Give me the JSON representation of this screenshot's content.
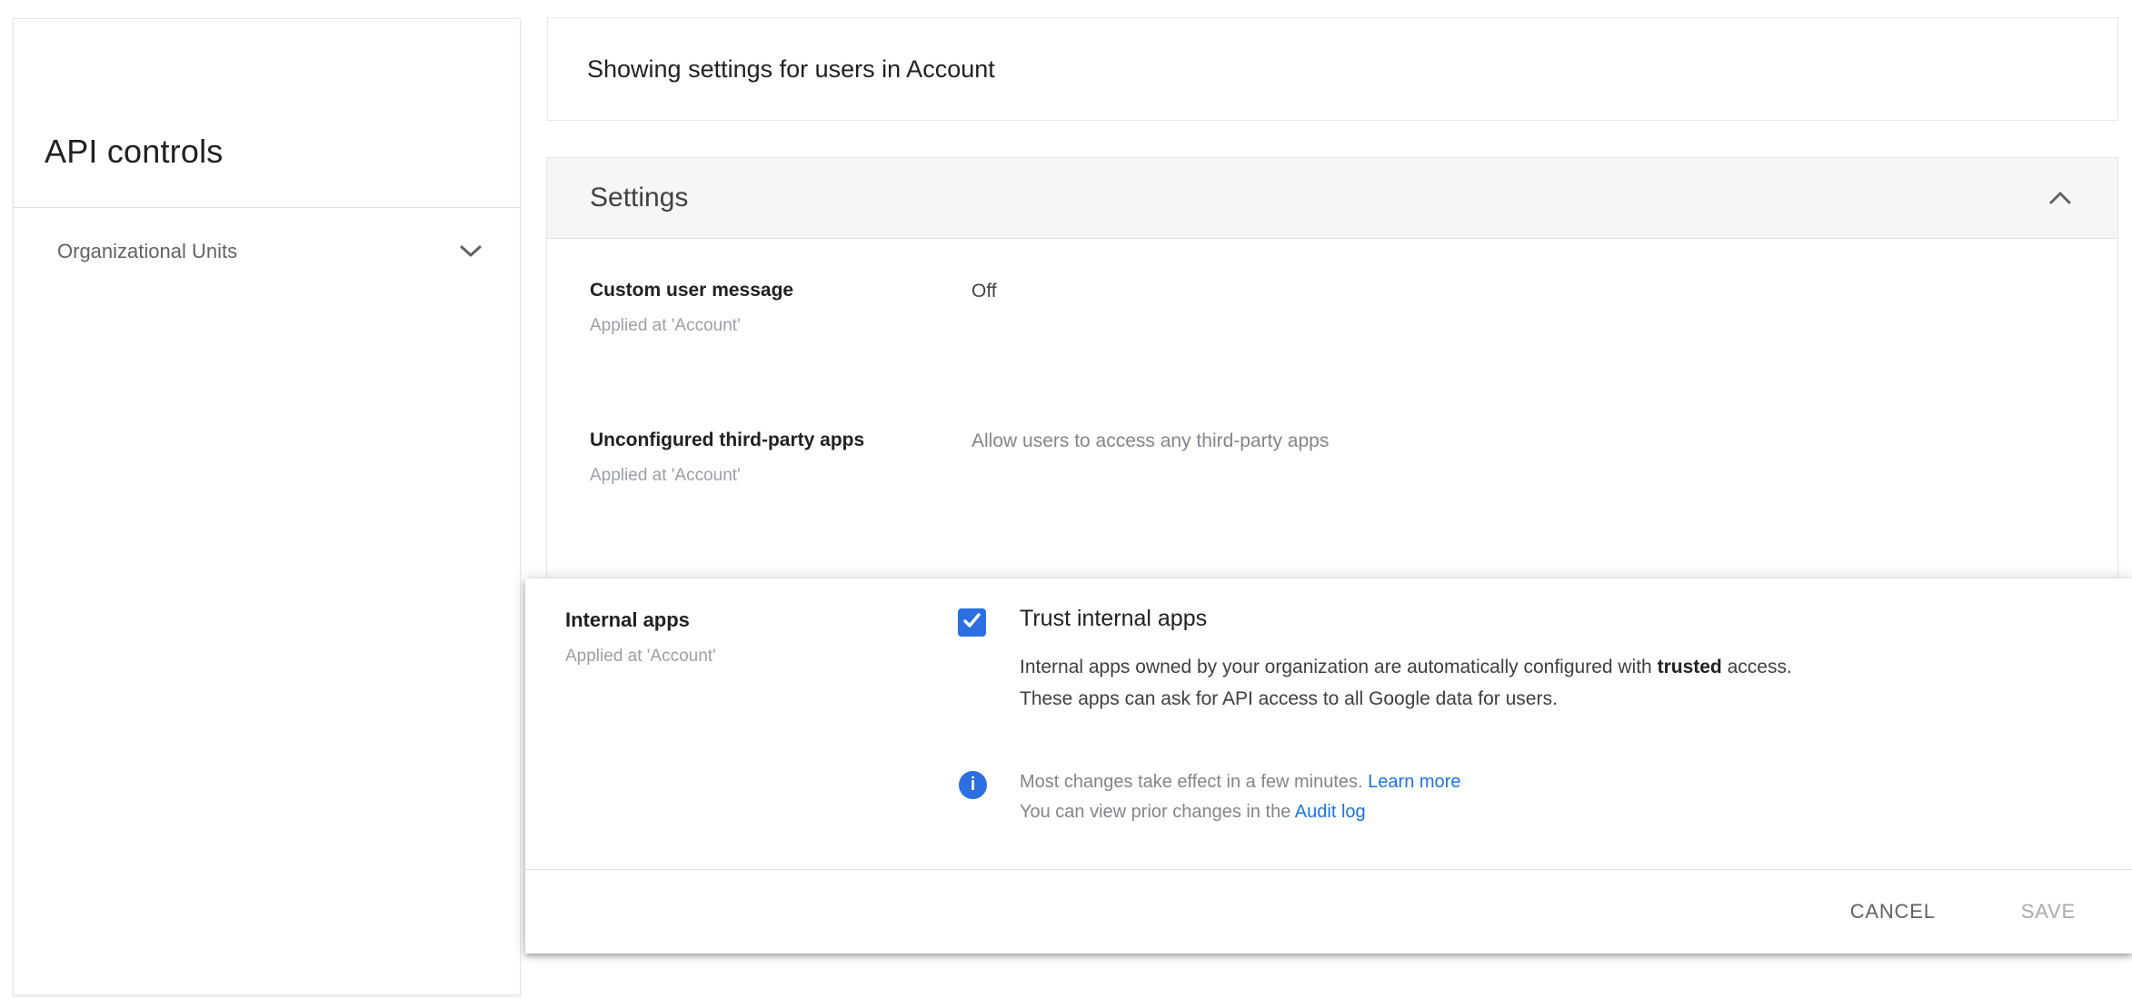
{
  "sidebar": {
    "title": "API controls",
    "org_units_label": "Organizational Units"
  },
  "scope_bar": {
    "text": "Showing settings for users in Account"
  },
  "settings_panel": {
    "header": "Settings",
    "rows": [
      {
        "label": "Custom user message",
        "applied_at": "Applied at 'Account'",
        "value": "Off"
      },
      {
        "label": "Unconfigured third-party apps",
        "applied_at": "Applied at 'Account'",
        "value": "Allow users to access any third-party apps"
      }
    ]
  },
  "internal_apps": {
    "label": "Internal apps",
    "applied_at": "Applied at 'Account'",
    "checkbox": {
      "checked": true,
      "label": "Trust internal apps"
    },
    "description": {
      "line1_before": "Internal apps owned by your organization are automatically configured with ",
      "line1_bold": "trusted",
      "line1_after": " access.",
      "line2": "These apps can ask for API access to all Google data for users."
    },
    "notice": {
      "line1_text": "Most changes take effect in a few minutes. ",
      "line1_link": "Learn more",
      "line2_text": "You can view prior changes in the ",
      "line2_link": "Audit log"
    },
    "actions": {
      "cancel": "CANCEL",
      "save": "SAVE"
    }
  },
  "icons": {
    "chevron_down": "chevron-down",
    "chevron_up": "chevron-up",
    "check": "checkmark",
    "info": "info"
  },
  "colors": {
    "accent_blue": "#2b6fe2",
    "link_blue": "#1a73e8",
    "header_bg": "#f6f6f6",
    "border": "#e0e0e0",
    "text_primary": "#212121",
    "text_secondary": "#80868b",
    "text_muted": "#9aa0a6"
  }
}
